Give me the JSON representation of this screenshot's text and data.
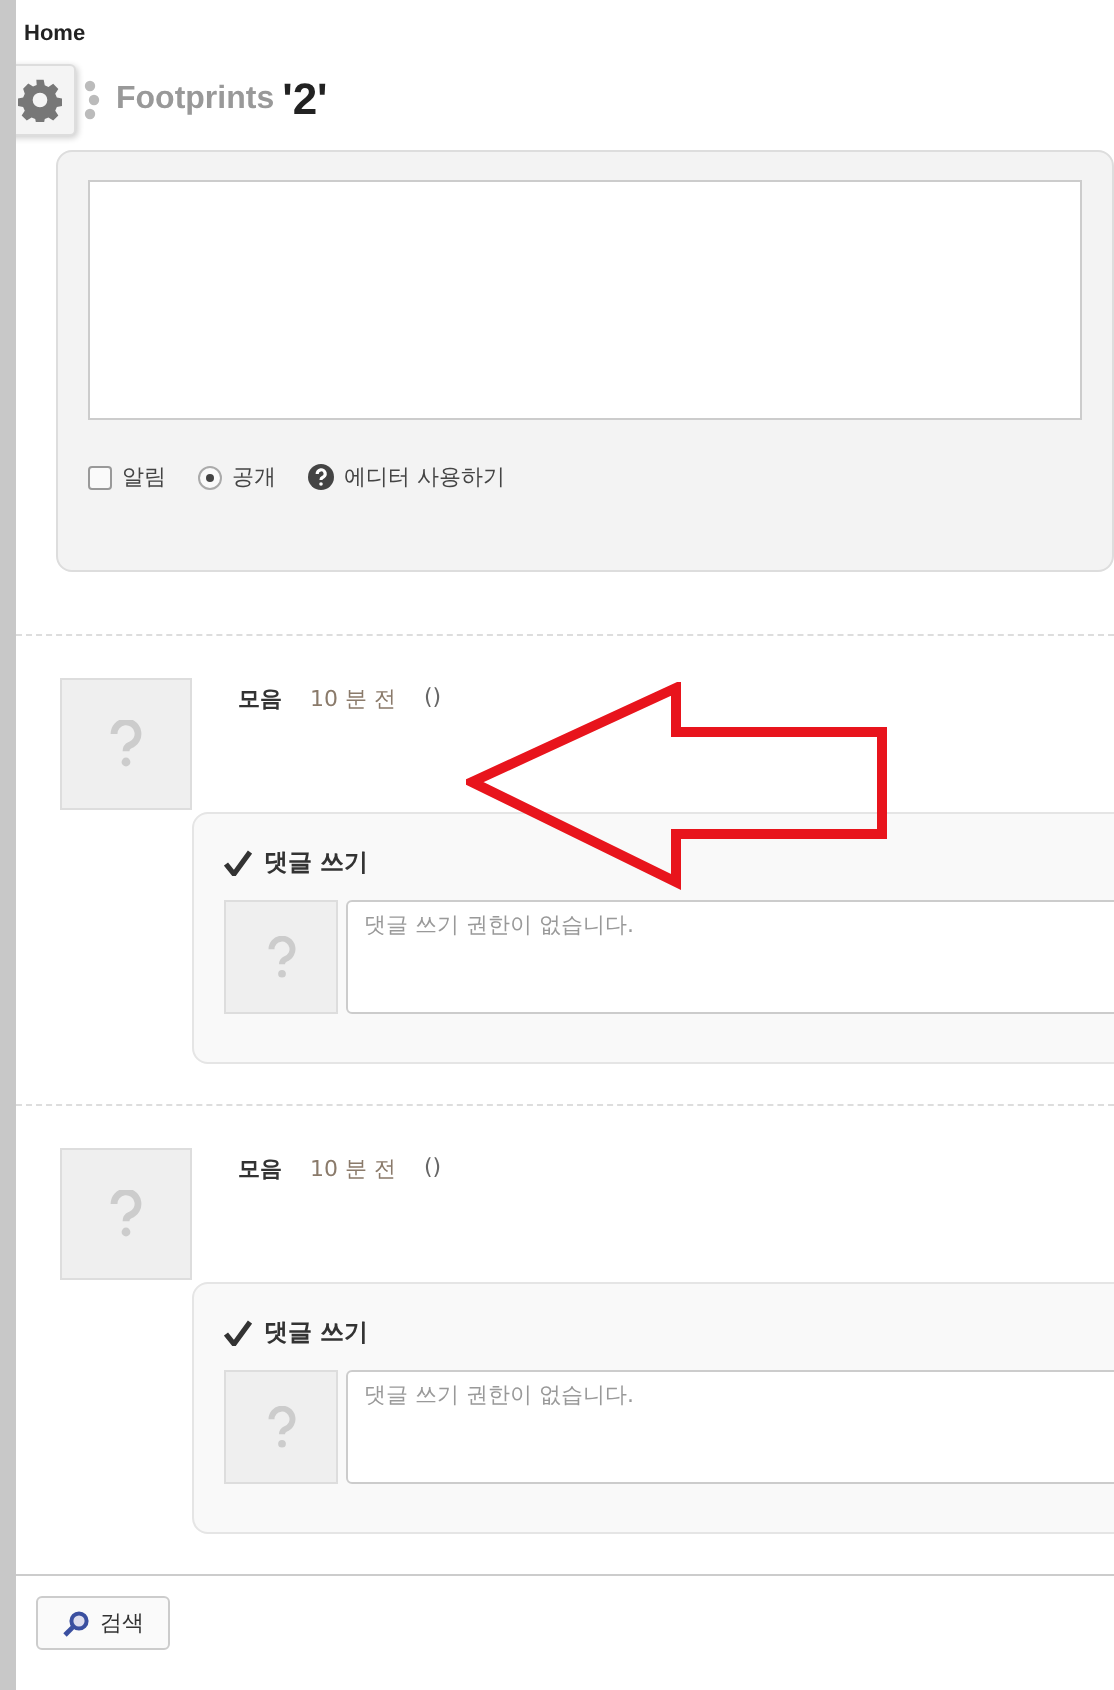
{
  "breadcrumb": "Home",
  "title": {
    "label": "Footprints",
    "count": "'2'"
  },
  "editor": {
    "options": [
      {
        "kind": "checkbox",
        "label": "알림",
        "checked": false
      },
      {
        "kind": "radio",
        "label": "공개",
        "selected": true
      },
      {
        "kind": "help",
        "label": "에디터 사용하기"
      }
    ]
  },
  "entries": [
    {
      "author": "모음",
      "time": "10 분 전",
      "extra": "()",
      "comment": {
        "heading": "댓글 쓰기",
        "placeholder": "댓글 쓰기 권한이 없습니다."
      }
    },
    {
      "author": "모음",
      "time": "10 분 전",
      "extra": "()",
      "comment": {
        "heading": "댓글 쓰기",
        "placeholder": "댓글 쓰기 권한이 없습니다."
      }
    }
  ],
  "annotation": {
    "kind": "arrow-left"
  },
  "search_button": "검색"
}
